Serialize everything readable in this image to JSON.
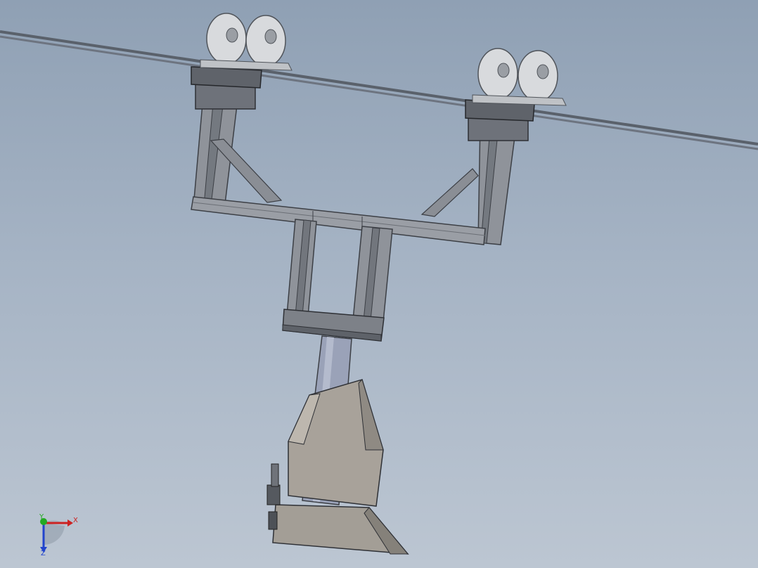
{
  "viewport": {
    "background_top": "#8fa0b4",
    "background_bottom": "#bcc6d2"
  },
  "model": {
    "steel_color": "#8f939a",
    "steel_dark": "#5c6068",
    "plate_color": "#a8a29a",
    "rod_color": "#9aa2b8",
    "wheel_color": "#d8dadd",
    "cable_color": "#59606a"
  },
  "axis_triad": {
    "x_label": "X",
    "y_label": "Y",
    "z_label": "Z",
    "x_color": "#cc2222",
    "y_color": "#22aa22",
    "z_color": "#2244cc"
  }
}
